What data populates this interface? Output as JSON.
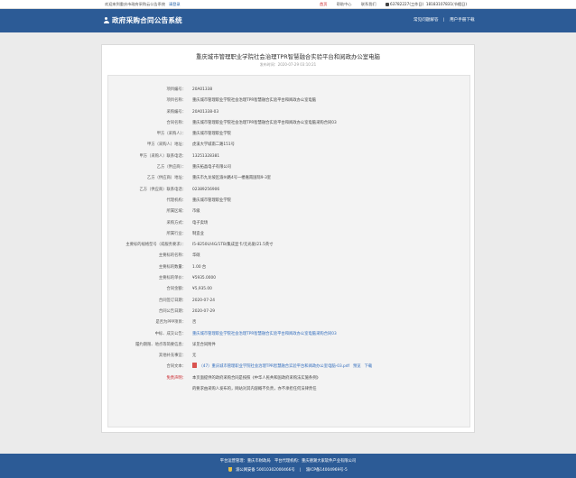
{
  "topbar": {
    "welcome": "欢迎来到重庆市政府采购云公告系统",
    "login": "请登录",
    "links": [
      "首页",
      "帮助中心",
      "联系我们"
    ],
    "phone": "63782227(工作日)",
    "phone2": "18183107831(节假日)"
  },
  "header": {
    "title": "政府采购合同公告系统",
    "links": [
      "常见问题解答",
      "用户手册下载"
    ]
  },
  "doc": {
    "title": "重庆城市管理职业学院社会治理TPR智慧融合实验平台和阅政办公室电脑",
    "date": "发布时间：2020-07-29 03:10:21"
  },
  "fields": [
    {
      "label": "项目编号：",
      "value": "20A01338"
    },
    {
      "label": "项目名称：",
      "value": "重庆城市管理职业学院社会治理TPR智慧融合实验平台和阅政办公室电脑"
    },
    {
      "label": "采购编号：",
      "value": "20A01338-03"
    },
    {
      "label": "合同名称：",
      "value": "重庆城市管理职业学院社会治理TPR智慧融合实验平台和阅政办公室电脑采购合同03"
    },
    {
      "label": "甲方（采购人）：",
      "value": "重庆城市管理职业学院"
    },
    {
      "label": "甲方（采购人）地址：",
      "value": "虎溪大学城南二路151号"
    },
    {
      "label": "甲方（采购人）联系电话：",
      "value": "13251328381"
    },
    {
      "label": "乙方（供应商）：",
      "value": "重庆拓晶电子有限公司"
    },
    {
      "label": "乙方（供应商）地址：",
      "value": "重庆市九龙坡区渝州路4号一楼嘉南国际9-3室"
    },
    {
      "label": "乙方（供应商）联系电话：",
      "value": "02389256906"
    },
    {
      "label": "代理机构：",
      "value": "重庆城市管理职业学院"
    },
    {
      "label": "所属区域：",
      "value": "市级"
    },
    {
      "label": "采购方式：",
      "value": "电子卖场"
    },
    {
      "label": "所属行业：",
      "value": "制造业"
    },
    {
      "label": "主要标的规格型号（或服务要求）：",
      "value": "I5-8250U/4G/1TB/集成显卡/无光驱/21.5英寸"
    },
    {
      "label": "主要标的名称：",
      "value": "华硕"
    },
    {
      "label": "主要标的数量：",
      "value": "1.00 台"
    },
    {
      "label": "主要标的单价：",
      "value": "¥5935.0000"
    },
    {
      "label": "合同金额：",
      "value": "¥5,935.00"
    },
    {
      "label": "合同签订日期：",
      "value": "2020-07-24"
    },
    {
      "label": "合同公告日期：",
      "value": "2020-07-29"
    },
    {
      "label": "是否为PPP项目：",
      "value": "否"
    },
    {
      "label": "中标、成交公告：",
      "value": "重庆城市管理职业学院社会治理TPR智慧融合实验平台和阅政办公室电脑采购合同03",
      "link": true
    },
    {
      "label": "履约期限、地点等简要信息：",
      "value": "详见合同附件"
    },
    {
      "label": "其他补充事宜：",
      "value": "无"
    }
  ],
  "attachment": {
    "label": "合同文本：",
    "name": "（47）重庆城市管理职业学院社会治理TPR智慧融合实验平台和阅政办公室电脑-03.pdf",
    "preview": "预览",
    "download": "下载"
  },
  "notice": {
    "label": "免责声明：",
    "line1": "本页面提供的政府采购合同是按照《中华人民共和国政府采购法实施条例》",
    "line2": "的要求由采购人发布的，网站对其内容概不负责，亦不承担任何法律责任"
  },
  "footer": {
    "line1": "平台运营管理：重庆市财政局　平台代理机构：重庆德潮大家软件产业有限公司",
    "police": "渝公网安备 50010302000466号",
    "icp": "渝ICP备14004969号-5"
  },
  "colors": {
    "brand": "#2c5b96",
    "link": "#2f6bbd",
    "alert": "#c8161d"
  }
}
